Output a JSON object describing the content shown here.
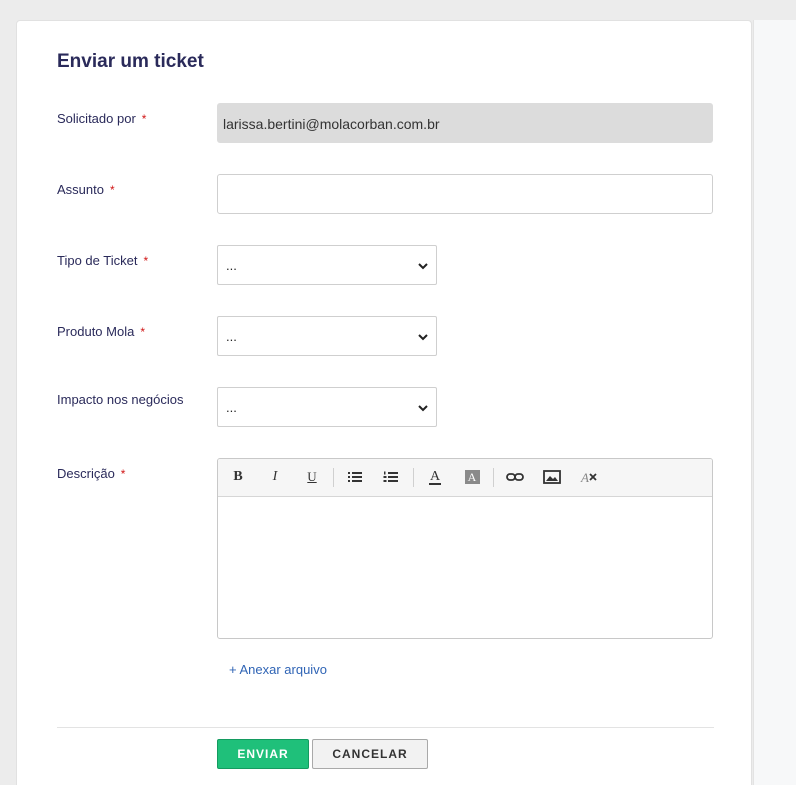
{
  "form": {
    "title": "Enviar um ticket",
    "required_marker": "*",
    "fields": {
      "requester": {
        "label": "Solicitado por",
        "value": "larissa.bertini@molacorban.com.br"
      },
      "subject": {
        "label": "Assunto",
        "value": "",
        "placeholder": ""
      },
      "ticket_type": {
        "label": "Tipo de Ticket",
        "value": "..."
      },
      "product": {
        "label": "Produto Mola",
        "value": "..."
      },
      "impact": {
        "label": "Impacto nos negócios",
        "value": "..."
      },
      "description": {
        "label": "Descrição"
      }
    },
    "toolbar": {
      "bold": "B",
      "italic": "I",
      "underline": "U",
      "font_color": "A",
      "bg_color": "A"
    },
    "attach_label": "+ Anexar arquivo",
    "submit_label": "ENVIAR",
    "cancel_label": "CANCELAR"
  },
  "colors": {
    "title": "#2a2a5a",
    "required": "#d01515",
    "primary_button": "#1fc07a",
    "link": "#2f64b5"
  }
}
